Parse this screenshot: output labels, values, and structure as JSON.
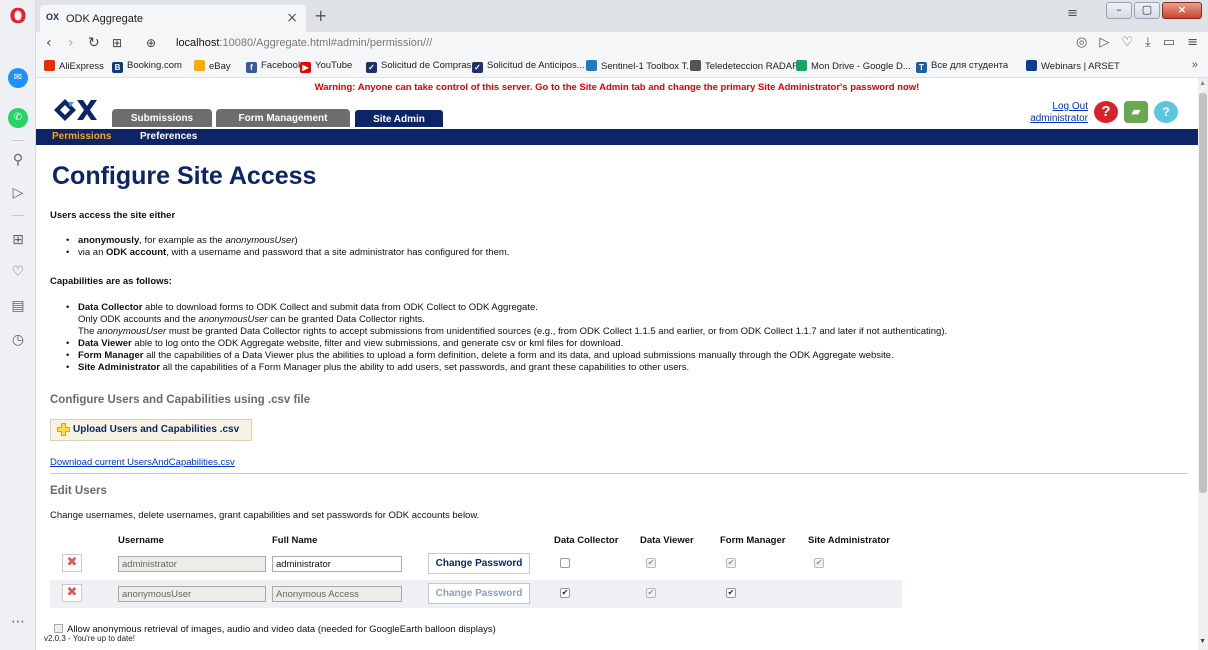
{
  "browser": {
    "tab_title": "ODK Aggregate",
    "tab_favicon": "OX",
    "url_host": "localhost",
    "url_path": ":10080/Aggregate.html#admin/permission///",
    "bookmarks": [
      {
        "label": "AliExpress",
        "icon": "aliexpress-icon",
        "color": "#e62e04",
        "glyph": ""
      },
      {
        "label": "Booking.com",
        "icon": "booking-icon",
        "color": "#0c3b7c",
        "glyph": "B"
      },
      {
        "label": "eBay",
        "icon": "ebay-icon",
        "color": "#f5af02",
        "glyph": ""
      },
      {
        "label": "Facebook",
        "icon": "facebook-icon",
        "color": "#3b5998",
        "glyph": "f"
      },
      {
        "label": "YouTube",
        "icon": "youtube-icon",
        "color": "#e00",
        "glyph": "▶"
      },
      {
        "label": "Solicitud de Compras...",
        "icon": "form-icon",
        "color": "#20306a",
        "glyph": "✓"
      },
      {
        "label": "Solicitud de Anticipos...",
        "icon": "form-icon",
        "color": "#20306a",
        "glyph": "✓"
      },
      {
        "label": "Sentinel-1 Toolbox T...",
        "icon": "sentinel-icon",
        "color": "#1e7bc0",
        "glyph": ""
      },
      {
        "label": "Teledeteccion RADAR...",
        "icon": "doc-icon",
        "color": "#555",
        "glyph": ""
      },
      {
        "label": "Mon Drive - Google D...",
        "icon": "drive-icon",
        "color": "#1aa260",
        "glyph": ""
      },
      {
        "label": "Все для студента",
        "icon": "t-icon",
        "color": "#1b5fa8",
        "glyph": "T"
      },
      {
        "label": "Webinars | ARSET",
        "icon": "nasa-icon",
        "color": "#0b3d91",
        "glyph": ""
      }
    ],
    "bookmarks_more": "»"
  },
  "app": {
    "warning": "Warning: Anyone can take control of this server. Go to the Site Admin tab and change the primary Site Administrator's password now!",
    "main_tabs": [
      {
        "label": "Submissions",
        "active": false
      },
      {
        "label": "Form Management",
        "active": false
      },
      {
        "label": "Site Admin",
        "active": true
      }
    ],
    "logout_label": "Log Out",
    "user_label": "administrator",
    "subnav": [
      {
        "label": "Permissions",
        "active": true
      },
      {
        "label": "Preferences",
        "active": false
      }
    ]
  },
  "content": {
    "title": "Configure Site Access",
    "access_intro": "Users access the site either",
    "access_items": [
      {
        "bold": "anonymously",
        "text": ", for example as the ",
        "em": "anonymousUser",
        "tail": ")"
      },
      {
        "pre": "via an ",
        "bold": "ODK account",
        "text": ", with a username and password that a site administrator has configured for them."
      }
    ],
    "capabilities_intro": "Capabilities are as follows:",
    "capabilities": {
      "dc_bold": "Data Collector",
      "dc_text": " able to download forms to ODK Collect and submit data from ODK Collect to ODK Aggregate.",
      "dc_line2_pre": "Only ODK accounts and the ",
      "dc_line2_em": "anonymousUser",
      "dc_line2_post": " can be granted Data Collector rights.",
      "dc_line3_pre": "The ",
      "dc_line3_em": "anonymousUser",
      "dc_line3_post": " must be granted Data Collector rights to accept submissions from unidentified sources (e.g., from ODK Collect 1.1.5 and earlier, or from ODK Collect 1.1.7 and later if not authenticating).",
      "dv_bold": "Data Viewer",
      "dv_text": " able to log onto the ODK Aggregate website, filter and view submissions, and generate csv or kml files for download.",
      "fm_bold": "Form Manager",
      "fm_text": " all the capabilities of a Data Viewer plus the abilities to upload a form definition, delete a form and its data, and upload submissions manually through the ODK Aggregate website.",
      "sa_bold": "Site Administrator",
      "sa_text": " all the capabilities of a Form Manager plus the ability to add users, set passwords, and grant these capabilities to other users."
    },
    "csv_heading": "Configure Users and Capabilities using .csv file",
    "upload_button": "Upload Users and Capabilities .csv",
    "download_link": "Download current UsersAndCapabilities.csv",
    "edit_heading": "Edit Users",
    "edit_desc": "Change usernames, delete usernames, grant capabilities and set passwords for ODK accounts below.",
    "table": {
      "headers": [
        "Username",
        "Full Name",
        "Data Collector",
        "Data Viewer",
        "Form Manager",
        "Site Administrator"
      ],
      "rows": [
        {
          "username": "administrator",
          "full_name": "administrator",
          "change_password": "Change Password",
          "data_collector": false,
          "data_viewer": true,
          "form_manager": true,
          "site_admin": true
        },
        {
          "username": "anonymousUser",
          "full_name": "Anonymous Access",
          "change_password": "Change Password",
          "data_collector": true,
          "data_viewer": true,
          "form_manager": true,
          "site_admin": false
        }
      ]
    },
    "anon_text": "Allow anonymous retrieval of images, audio and video data (needed for GoogleEarth balloon displays)",
    "version": "v2.0.3 - You're up to date!"
  }
}
